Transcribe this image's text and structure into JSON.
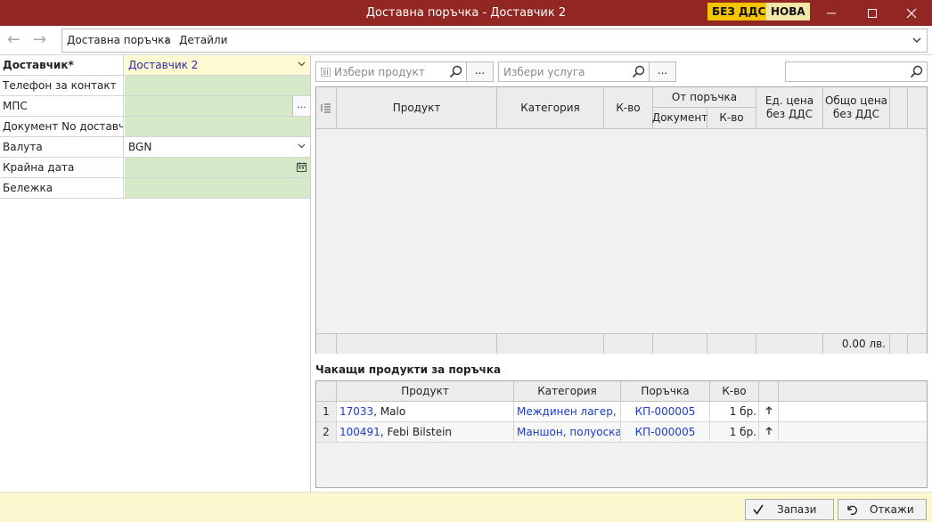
{
  "window": {
    "title": "Доставна поръчка - Доставчик 2",
    "badge_vat": "БЕЗ ДДС",
    "badge_new": "НОВА"
  },
  "nav": {
    "crumb_root": "Доставна поръчка",
    "crumb_current": "Детайли"
  },
  "form": {
    "supplier_label": "Доставчик*",
    "supplier_value": "Доставчик 2",
    "phone_label": "Телефон за контакт",
    "mps_label": "МПС",
    "docno_label": "Документ No доставчик",
    "currency_label": "Валута",
    "currency_value": "BGN",
    "due_label": "Крайна дата",
    "note_label": "Бележка",
    "dots": "..."
  },
  "search": {
    "product_placeholder": "Избери продукт",
    "service_placeholder": "Избери услуга",
    "dots": "..."
  },
  "grid": {
    "col_product": "Продукт",
    "col_category": "Категория",
    "col_qty": "К-во",
    "col_from_order": "От поръчка",
    "col_document": "Документ",
    "col_order_qty": "К-во",
    "col_unit_price_l1": "Ед. цена",
    "col_unit_price_l2": "без ДДС",
    "col_total_l1": "Общо цена",
    "col_total_l2": "без ДДС",
    "total": "0.00 лв."
  },
  "pending": {
    "title": "Чакащи продукти за поръчка",
    "col_product": "Продукт",
    "col_category": "Категория",
    "col_order": "Поръчка",
    "col_qty": "К-во",
    "rows": [
      {
        "num": "1",
        "code": "17033",
        "name": ", Malo",
        "category": "Междинен лагер, п...",
        "order": "КП-000005",
        "qty": "1 бр."
      },
      {
        "num": "2",
        "code": "100491",
        "name": ", Febi Bilstein",
        "category": "Маншон, полуоска",
        "order": "КП-000005",
        "qty": "1 бр."
      }
    ]
  },
  "actions": {
    "save": "Запази",
    "cancel": "Откажи"
  },
  "colors": {
    "titlebar": "#922622",
    "badge_vat": "#f5c400",
    "field_green": "#d5e8c8",
    "field_yellow": "#fdf9d2",
    "link": "#1b3dc7"
  }
}
